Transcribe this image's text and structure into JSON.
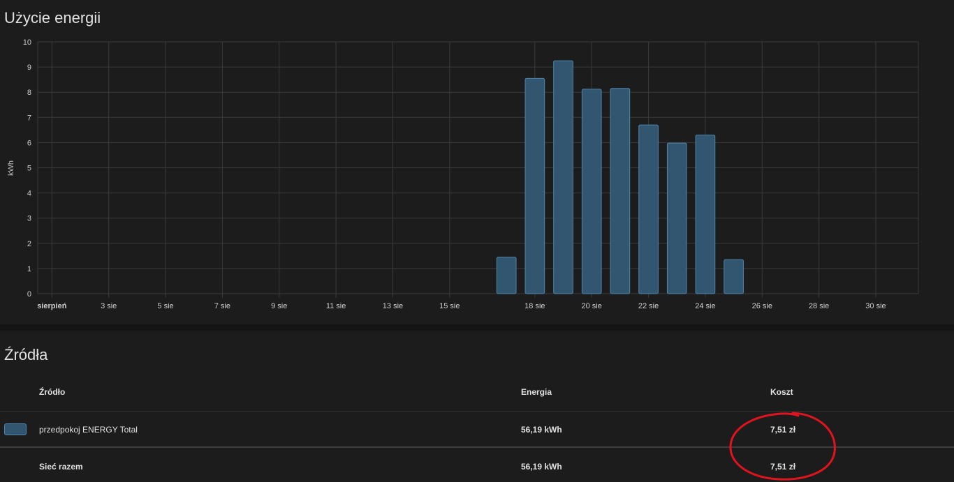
{
  "energy_card": {
    "title": "Użycie energii"
  },
  "chart_data": {
    "type": "bar",
    "ylabel": "kWh",
    "ylim": [
      0,
      10
    ],
    "yticks": [
      0,
      1,
      2,
      3,
      4,
      5,
      6,
      7,
      8,
      9,
      10
    ],
    "x_tick_labels": [
      "sierpień",
      "3 sie",
      "5 sie",
      "7 sie",
      "9 sie",
      "11 sie",
      "13 sie",
      "15 sie",
      "18 sie",
      "20 sie",
      "22 sie",
      "24 sie",
      "26 sie",
      "28 sie",
      "30 sie"
    ],
    "bar_color": "#325570",
    "bar_border_color": "#4e86ad",
    "categories": [
      "17 sie",
      "18 sie",
      "19 sie",
      "20 sie",
      "21 sie",
      "22 sie",
      "23 sie",
      "24 sie",
      "25 sie"
    ],
    "values": [
      1.45,
      8.55,
      9.25,
      8.12,
      8.15,
      6.7,
      5.98,
      6.3,
      1.35
    ],
    "grid": true
  },
  "sources_card": {
    "title": "Źródła",
    "columns": {
      "source": "Źródło",
      "energy": "Energia",
      "cost": "Koszt"
    },
    "rows": [
      {
        "swatch_color": "#325570",
        "source": "przedpokoj ENERGY Total",
        "energy": "56,19 kWh",
        "cost": "7,51 zł"
      }
    ],
    "total": {
      "label": "Sieć razem",
      "energy": "56,19 kWh",
      "cost": "7,51 zł"
    },
    "annotation_color": "#e0141e"
  }
}
